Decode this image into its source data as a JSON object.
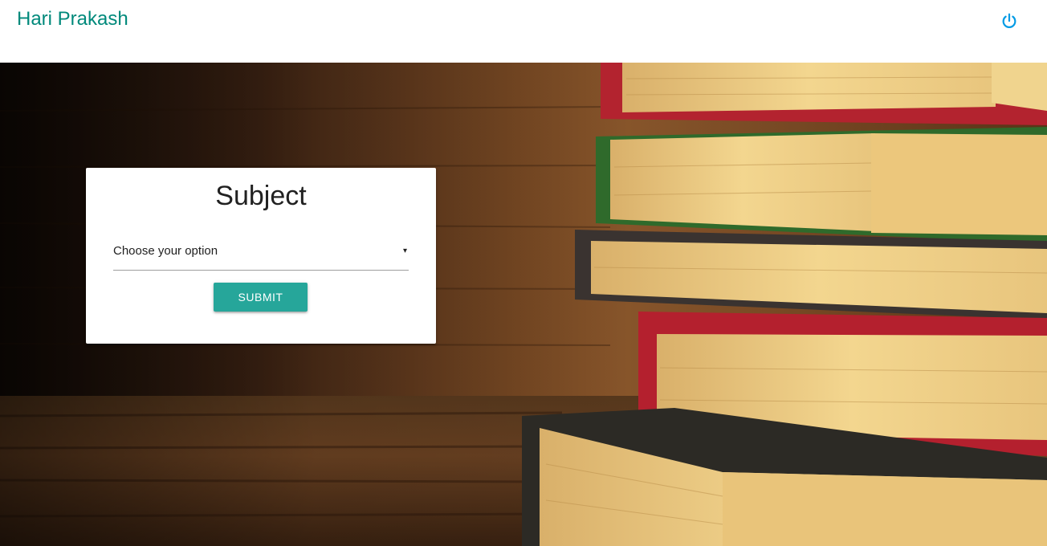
{
  "navbar": {
    "brand": "Hari Prakash",
    "power_icon": "power-icon",
    "brand_color": "#00897b",
    "icon_color": "#039be5"
  },
  "hero": {
    "background_image": "stacked-books-photo"
  },
  "card": {
    "title": "Subject",
    "select": {
      "selected_value": "Choose your option",
      "caret": "▾"
    },
    "submit_label": "SUBMIT",
    "button_color": "#26a69a"
  }
}
